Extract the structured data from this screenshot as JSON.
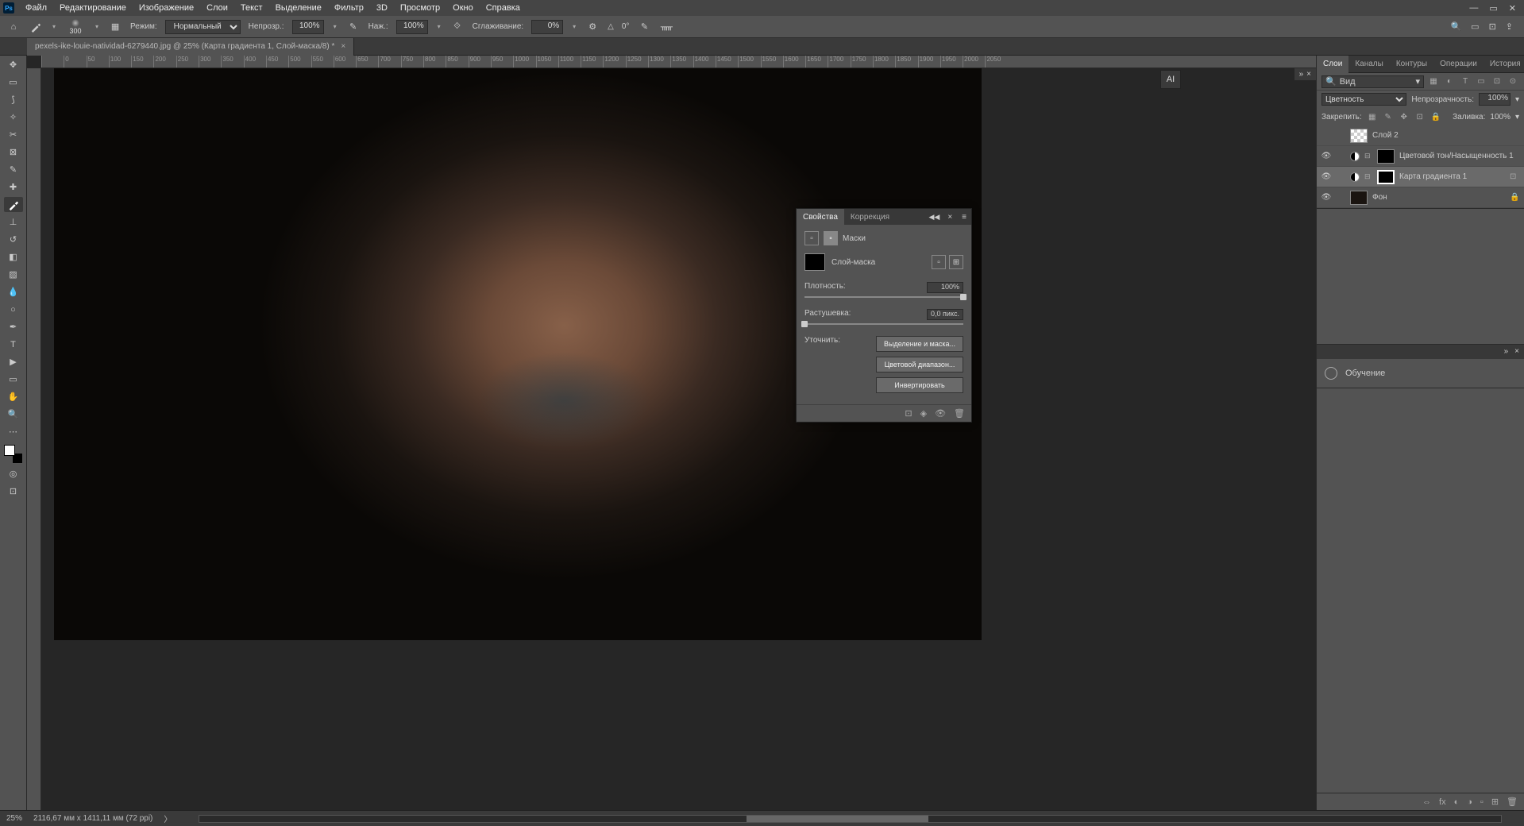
{
  "menubar": {
    "items": [
      "Файл",
      "Редактирование",
      "Изображение",
      "Слои",
      "Текст",
      "Выделение",
      "Фильтр",
      "3D",
      "Просмотр",
      "Окно",
      "Справка"
    ]
  },
  "optionsbar": {
    "brush_size": "300",
    "mode_label": "Режим:",
    "mode_value": "Нормальный",
    "opacity_label": "Непрозр.:",
    "opacity_value": "100%",
    "flow_label": "Наж.:",
    "flow_value": "100%",
    "smoothing_label": "Сглаживание:",
    "smoothing_value": "0%",
    "angle_icon": "△",
    "angle_value": "0°"
  },
  "doc_tab": {
    "title": "pexels-ike-louie-natividad-6279440.jpg @ 25% (Карта градиента 1, Слой-маска/8) *"
  },
  "ruler_h_ticks": [
    "",
    "0",
    "50",
    "100",
    "150",
    "200",
    "250",
    "300",
    "350",
    "400",
    "450",
    "500",
    "550",
    "600",
    "650",
    "700",
    "750",
    "800",
    "850",
    "900",
    "950",
    "1000",
    "1050",
    "1100",
    "1150",
    "1200",
    "1250",
    "1300",
    "1350",
    "1400",
    "1450",
    "1500",
    "1550",
    "1600",
    "1650",
    "1700",
    "1750",
    "1800",
    "1850",
    "1900",
    "1950",
    "2000",
    "2050"
  ],
  "ai_tag": "AI",
  "panels": {
    "tabs": [
      "Слои",
      "Каналы",
      "Контуры",
      "Операции",
      "История"
    ],
    "active_tab": 0
  },
  "layers": {
    "search_label": "Вид",
    "blend_mode": "Цветность",
    "opacity_label": "Непрозрачность:",
    "opacity_value": "100%",
    "lock_label": "Закрепить:",
    "fill_label": "Заливка:",
    "fill_value": "100%",
    "rows": [
      {
        "eye": false,
        "name": "Слой 2",
        "type": "normal",
        "trans": true
      },
      {
        "eye": true,
        "name": "Цветовой тон/Насыщенность 1",
        "type": "adj",
        "mask": true
      },
      {
        "eye": true,
        "name": "Карта градиента 1",
        "type": "adj",
        "mask": true,
        "selected": true,
        "smart": true
      },
      {
        "eye": true,
        "name": "Фон",
        "type": "bg",
        "locked": true
      }
    ]
  },
  "properties": {
    "tabs": [
      "Свойства",
      "Коррекция"
    ],
    "masks_label": "Маски",
    "layer_mask_label": "Слой-маска",
    "density_label": "Плотность:",
    "density_value": "100%",
    "feather_label": "Растушевка:",
    "feather_value": "0,0 пикс.",
    "refine_label": "Уточнить:",
    "btn_select_mask": "Выделение и маска...",
    "btn_color_range": "Цветовой диапазон...",
    "btn_invert": "Инвертировать"
  },
  "learn": {
    "label": "Обучение"
  },
  "statusbar": {
    "zoom": "25%",
    "doc_info": "2116,67 мм x 1411,11 мм (72 ppi)"
  }
}
